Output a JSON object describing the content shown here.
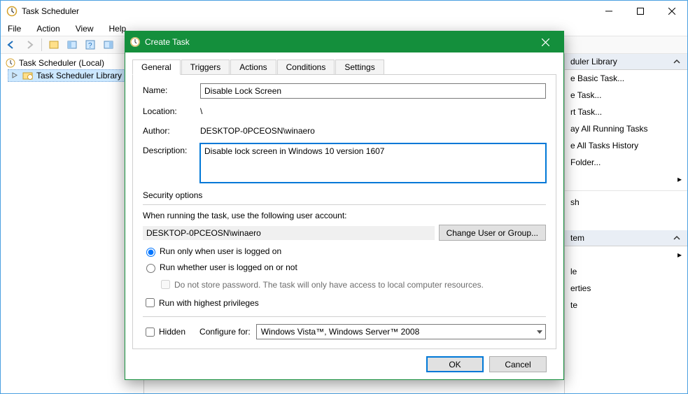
{
  "main_window": {
    "title": "Task Scheduler",
    "menubar": {
      "file": "File",
      "action": "Action",
      "view": "View",
      "help": "Help"
    },
    "tree": {
      "root": "Task Scheduler (Local)",
      "lib": "Task Scheduler Library"
    },
    "actions": {
      "panel_title": "duler Library",
      "items": [
        "e Basic Task...",
        "e Task...",
        "rt Task...",
        "ay All Running Tasks",
        "e All Tasks History",
        "Folder...",
        "",
        "sh",
        "",
        "tem",
        "",
        "le",
        "erties",
        "te",
        ""
      ]
    }
  },
  "dialog": {
    "title": "Create Task",
    "tabs": {
      "general": "General",
      "triggers": "Triggers",
      "actions": "Actions",
      "conditions": "Conditions",
      "settings": "Settings"
    },
    "general": {
      "name_label": "Name:",
      "name_value": "Disable Lock Screen",
      "location_label": "Location:",
      "location_value": "\\",
      "author_label": "Author:",
      "author_value": "DESKTOP-0PCEOSN\\winaero",
      "description_label": "Description:",
      "description_value": "Disable lock screen in Windows 10 version 1607",
      "security_header": "Security options",
      "security_text": "When running the task, use the following user account:",
      "security_user": "DESKTOP-0PCEOSN\\winaero",
      "change_user_btn": "Change User or Group...",
      "radio_logged_on": "Run only when user is logged on",
      "radio_not_logged": "Run whether user is logged on or not",
      "no_store_pw": "Do not store password.  The task will only have access to local computer resources.",
      "highest_priv": "Run with highest privileges",
      "hidden": "Hidden",
      "configure_label": "Configure for:",
      "configure_value": "Windows Vista™, Windows Server™ 2008"
    },
    "buttons": {
      "ok": "OK",
      "cancel": "Cancel"
    }
  }
}
